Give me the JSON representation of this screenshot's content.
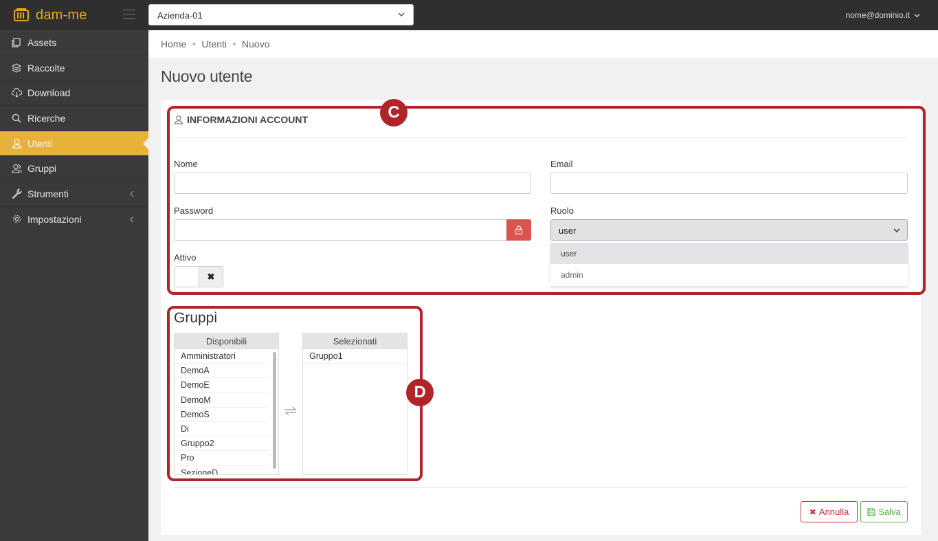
{
  "app": {
    "name": "dam-me"
  },
  "header": {
    "company": "Azienda-01",
    "user_email": "nome@dominio.it"
  },
  "sidebar": {
    "items": [
      {
        "label": "Assets",
        "icon": "copy-icon",
        "active": false
      },
      {
        "label": "Raccolte",
        "icon": "layers-icon",
        "active": false
      },
      {
        "label": "Download",
        "icon": "cloud-download-icon",
        "active": false
      },
      {
        "label": "Ricerche",
        "icon": "search-icon",
        "active": false
      },
      {
        "label": "Utenti",
        "icon": "user-icon",
        "active": true
      },
      {
        "label": "Gruppi",
        "icon": "users-icon",
        "active": false
      },
      {
        "label": "Strumenti",
        "icon": "wrench-icon",
        "active": false,
        "has_submenu": true
      },
      {
        "label": "Impostazioni",
        "icon": "gear-icon",
        "active": false,
        "has_submenu": true
      }
    ],
    "active_color": "#e8b13a"
  },
  "breadcrumb": [
    "Home",
    "Utenti",
    "Nuovo"
  ],
  "page": {
    "title": "Nuovo utente"
  },
  "account": {
    "title": "INFORMAZIONI ACCOUNT",
    "nome_label": "Nome",
    "email_label": "Email",
    "password_label": "Password",
    "ruolo_label": "Ruolo",
    "ruolo_value": "user",
    "ruolo_options": [
      "user",
      "admin"
    ],
    "attivo_label": "Attivo",
    "attivo_state": "off"
  },
  "gruppi": {
    "title": "Gruppi",
    "available_header": "Disponibili",
    "selected_header": "Selezionati",
    "available": [
      "Amministratori",
      "DemoA",
      "DemoE",
      "DemoM",
      "DemoS",
      "Di",
      "Gruppo2",
      "Pro",
      "SezioneD"
    ],
    "selected": [
      "Gruppo1"
    ]
  },
  "annotations": {
    "c": "C",
    "d": "D",
    "color": "#b0242a"
  },
  "actions": {
    "cancel": "Annulla",
    "save": "Salva"
  }
}
